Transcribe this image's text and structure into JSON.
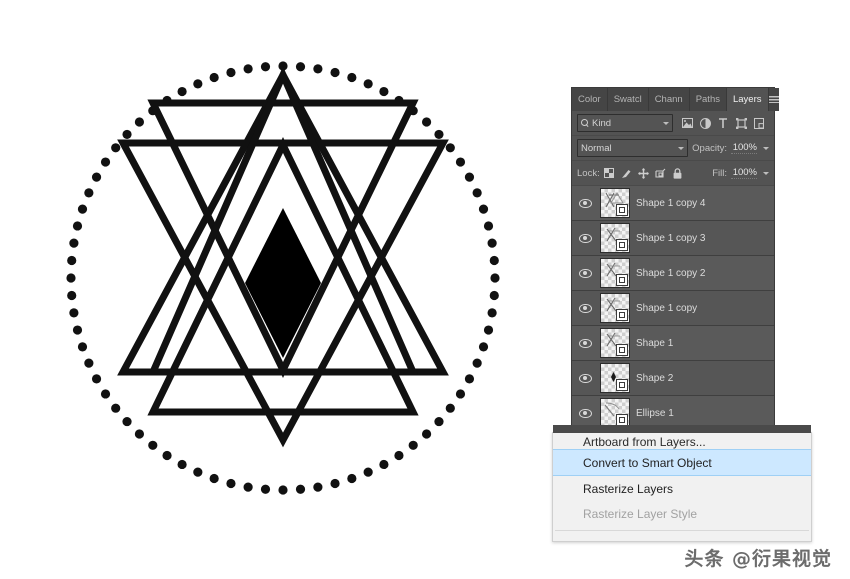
{
  "app": {
    "name": "Adobe Photoshop",
    "canvas_background": "#ffffff"
  },
  "artwork": {
    "name": "sacred-geometry-composition",
    "stroke_color": "#111111",
    "fill_color": "#000000",
    "description": "Dotted circle enclosing overlapping triangles with a solid black diamond at center"
  },
  "panel": {
    "title": "Layers",
    "tabs": [
      {
        "label": "Color",
        "active": false
      },
      {
        "label": "Swatcl",
        "active": false
      },
      {
        "label": "Chann",
        "active": false
      },
      {
        "label": "Paths",
        "active": false
      },
      {
        "label": "Layers",
        "active": true
      }
    ],
    "menu_icon": "hamburger-icon",
    "filter": {
      "search_icon": "search-icon",
      "kind_label": "Kind",
      "icons": [
        "pixel-layer-filter-icon",
        "adjustment-layer-filter-icon",
        "type-layer-filter-icon",
        "shape-layer-filter-icon",
        "smart-object-filter-icon"
      ]
    },
    "blend": {
      "mode": "Normal",
      "opacity_label": "Opacity:",
      "opacity_value": "100%"
    },
    "lock": {
      "label": "Lock:",
      "icons": [
        "lock-transparent-pixels-icon",
        "lock-image-pixels-icon",
        "lock-position-icon",
        "lock-artboard-nesting-icon",
        "lock-all-icon"
      ],
      "fill_label": "Fill:",
      "fill_value": "100%"
    },
    "layers": [
      {
        "name": "Shape 1 copy 4",
        "visible": true,
        "thumb": "two-triangles-thumb"
      },
      {
        "name": "Shape 1 copy 3",
        "visible": true,
        "thumb": "triangle-thumb"
      },
      {
        "name": "Shape 1 copy 2",
        "visible": true,
        "thumb": "triangle-thumb"
      },
      {
        "name": "Shape 1 copy",
        "visible": true,
        "thumb": "triangle-thumb"
      },
      {
        "name": "Shape 1",
        "visible": true,
        "thumb": "triangle-thumb"
      },
      {
        "name": "Shape 2",
        "visible": true,
        "thumb": "diamond-thumb"
      },
      {
        "name": "Ellipse 1",
        "visible": true,
        "thumb": "ellipse-thumb"
      }
    ]
  },
  "context_menu": {
    "items": [
      {
        "label": "Artboard from Layers...",
        "state": "clipped"
      },
      {
        "label": "Convert to Smart Object",
        "state": "highlighted"
      },
      {
        "label": "Rasterize Layers",
        "state": "normal"
      },
      {
        "label": "Rasterize Layer Style",
        "state": "disabled"
      }
    ],
    "highlight_color": "#cde8ff"
  },
  "watermark": {
    "text": "头条 @衍果视觉"
  }
}
